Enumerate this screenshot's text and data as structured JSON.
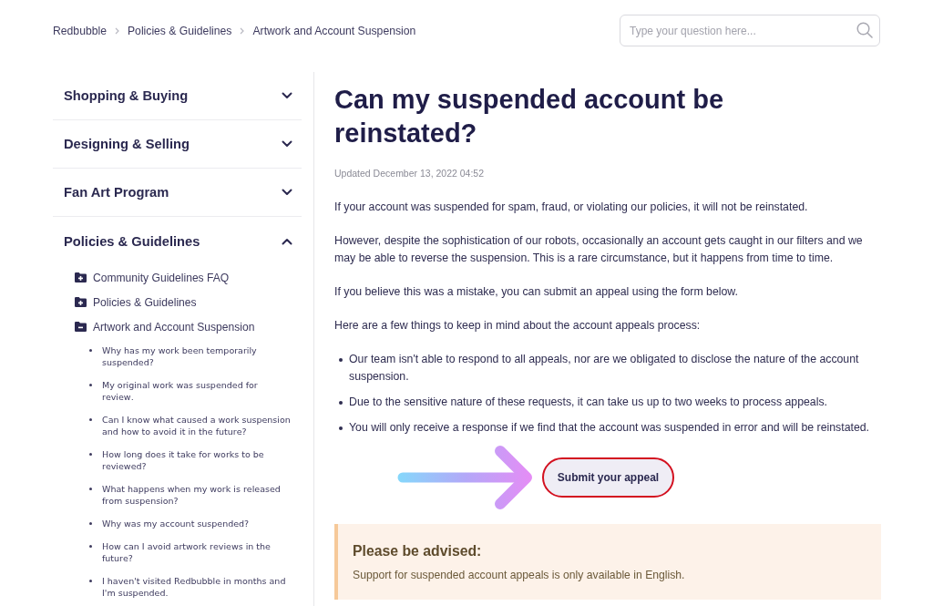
{
  "breadcrumb": [
    {
      "label": "Redbubble"
    },
    {
      "label": "Policies & Guidelines"
    },
    {
      "label": "Artwork and Account Suspension"
    }
  ],
  "search": {
    "placeholder": "Type your question here..."
  },
  "sidebar": {
    "sections": [
      {
        "title": "Shopping & Buying",
        "expanded": false
      },
      {
        "title": "Designing & Selling",
        "expanded": false
      },
      {
        "title": "Fan Art Program",
        "expanded": false
      },
      {
        "title": "Policies & Guidelines",
        "expanded": true,
        "children": [
          {
            "title": "Community Guidelines FAQ",
            "expanded": false
          },
          {
            "title": "Policies & Guidelines",
            "expanded": false
          },
          {
            "title": "Artwork and Account Suspension",
            "expanded": true,
            "children": [
              {
                "title": "Why has my work been temporarily suspended?"
              },
              {
                "title": "My original work was suspended for review."
              },
              {
                "title": "Can I know what caused a work suspension and how to avoid it in the future?"
              },
              {
                "title": "How long does it take for works to be reviewed?"
              },
              {
                "title": "What happens when my work is released from suspension?"
              },
              {
                "title": "Why was my account suspended?"
              },
              {
                "title": "How can I avoid artwork reviews in the future?"
              },
              {
                "title": "I haven't visited Redbubble in months and I'm suspended."
              }
            ]
          }
        ]
      }
    ]
  },
  "article": {
    "title": "Can my suspended account be reinstated?",
    "updated": "Updated December 13, 2022 04:52",
    "paragraphs": [
      "If your account was suspended for spam, fraud, or violating our policies, it will not be reinstated.",
      "However, despite the sophistication of our robots, occasionally an account gets caught in our filters and we may be able to reverse the suspension. This is a rare circumstance, but it happens from time to time.",
      "If you believe this was a mistake, you can submit an appeal using the form below.",
      "Here are a few things to keep in mind about the account appeals process:"
    ],
    "bullets": [
      "Our team isn't able to respond to all appeals, nor are we obligated to disclose the nature of the account suspension.",
      "Due to the sensitive nature of these requests, it can take us up to two weeks to process appeals.",
      "You will only receive a response if we find that the account was suspended in error and will be reinstated."
    ],
    "button": {
      "label": "Submit your appeal"
    },
    "notice": {
      "title": "Please be advised:",
      "text": "Support for suspended account appeals is only available in English."
    }
  }
}
